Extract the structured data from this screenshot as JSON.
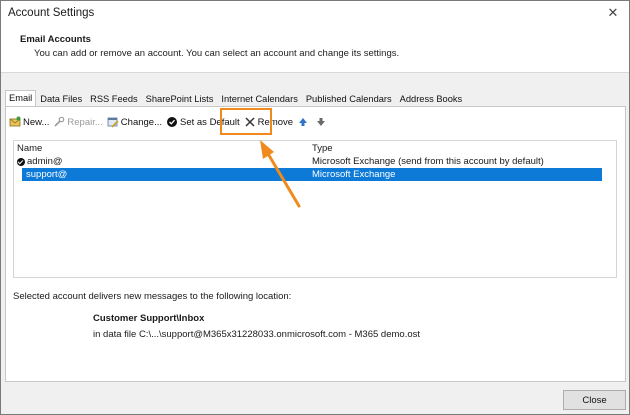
{
  "window": {
    "title": "Account Settings"
  },
  "header": {
    "title": "Email Accounts",
    "description": "You can add or remove an account. You can select an account and change its settings."
  },
  "tabs": [
    {
      "label": "Email",
      "active": true
    },
    {
      "label": "Data Files"
    },
    {
      "label": "RSS Feeds"
    },
    {
      "label": "SharePoint Lists"
    },
    {
      "label": "Internet Calendars"
    },
    {
      "label": "Published Calendars"
    },
    {
      "label": "Address Books"
    }
  ],
  "toolbar": {
    "new_label": "New...",
    "repair_label": "Repair...",
    "change_label": "Change...",
    "set_default_label": "Set as Default",
    "remove_label": "Remove"
  },
  "accounts": {
    "col_name": "Name",
    "col_type": "Type",
    "rows": [
      {
        "name": "admin@",
        "type": "Microsoft Exchange (send from this account by default)",
        "default": true
      },
      {
        "name": "support@",
        "type": "Microsoft Exchange",
        "selected": true
      }
    ]
  },
  "location": {
    "text": "Selected account delivers new messages to the following location:",
    "folder": "Customer Support\\Inbox",
    "file": "in data file C:\\...\\support@M365x31228033.onmicrosoft.com - M365 demo.ost"
  },
  "footer": {
    "close_label": "Close"
  },
  "colors": {
    "highlight": "#f08a1c",
    "selection": "#0d7ad8"
  }
}
